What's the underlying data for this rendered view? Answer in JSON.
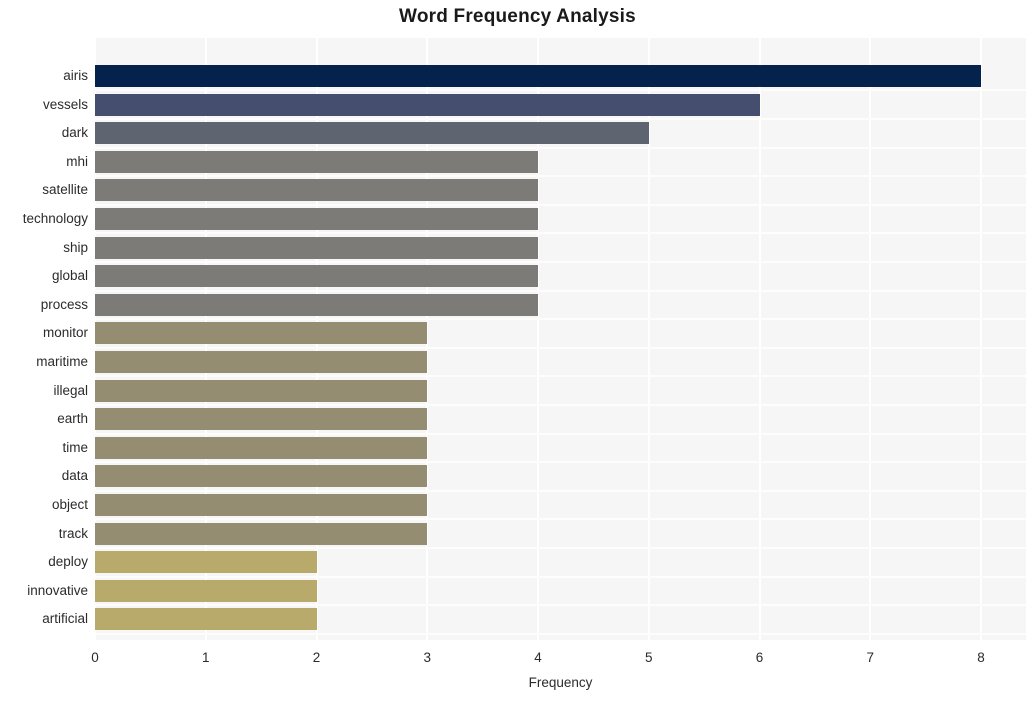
{
  "chart_data": {
    "type": "bar",
    "orientation": "horizontal",
    "title": "Word Frequency Analysis",
    "xlabel": "Frequency",
    "ylabel": "",
    "categories": [
      "airis",
      "vessels",
      "dark",
      "mhi",
      "satellite",
      "technology",
      "ship",
      "global",
      "process",
      "monitor",
      "maritime",
      "illegal",
      "earth",
      "time",
      "data",
      "object",
      "track",
      "deploy",
      "innovative",
      "artificial"
    ],
    "values": [
      8,
      6,
      5,
      4,
      4,
      4,
      4,
      4,
      4,
      3,
      3,
      3,
      3,
      3,
      3,
      3,
      3,
      2,
      2,
      2
    ],
    "bar_colors": [
      "#04224c",
      "#454e6e",
      "#5f6471",
      "#7d7b77",
      "#7d7b77",
      "#7d7b77",
      "#7d7b77",
      "#7d7b77",
      "#7d7b77",
      "#958d72",
      "#958d72",
      "#958d72",
      "#958d72",
      "#958d72",
      "#958d72",
      "#958d72",
      "#958d72",
      "#b8aa6b",
      "#b8aa6b",
      "#b8aa6b"
    ],
    "xlim": [
      0,
      8.41
    ],
    "xticks": [
      0,
      1,
      2,
      3,
      4,
      5,
      6,
      7,
      8
    ],
    "xtick_labels": [
      "0",
      "1",
      "2",
      "3",
      "4",
      "5",
      "6",
      "7",
      "8"
    ],
    "grid": true,
    "grid_color": "#ffffff",
    "plot_background": "#f6f6f7",
    "figure_background": "#ffffff",
    "legend": null,
    "legend_position": "none"
  }
}
